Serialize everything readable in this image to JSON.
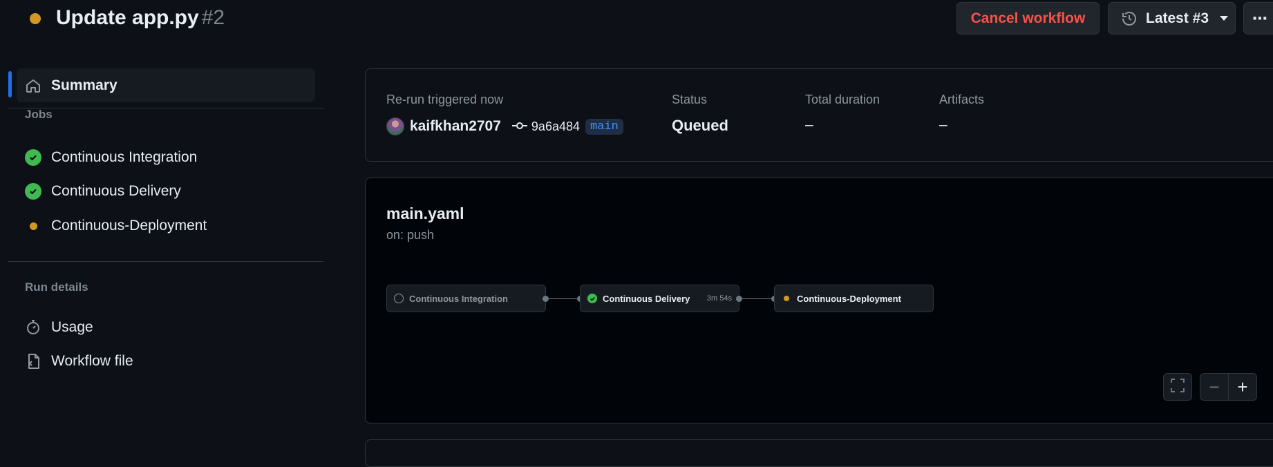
{
  "header": {
    "title": "Update app.py",
    "run_number": "#2",
    "cancel_label": "Cancel workflow",
    "latest_label": "Latest #3",
    "more_label": "⋯"
  },
  "sidebar": {
    "summary_label": "Summary",
    "jobs_heading": "Jobs",
    "jobs": [
      {
        "label": "Continuous Integration",
        "status": "success"
      },
      {
        "label": "Continuous Delivery",
        "status": "success"
      },
      {
        "label": "Continuous-Deployment",
        "status": "queued"
      }
    ],
    "run_details_heading": "Run details",
    "details": [
      {
        "label": "Usage",
        "icon": "stopwatch-icon"
      },
      {
        "label": "Workflow file",
        "icon": "file-code-icon"
      }
    ]
  },
  "summary": {
    "trigger_label": "Re-run triggered now",
    "actor": "kaifkhan2707",
    "commit": "9a6a484",
    "branch": "main",
    "status_label": "Status",
    "status_value": "Queued",
    "duration_label": "Total duration",
    "duration_value": "–",
    "artifacts_label": "Artifacts",
    "artifacts_value": "–"
  },
  "graph": {
    "workflow_name": "main.yaml",
    "trigger": "on: push",
    "jobs": [
      {
        "label": "Continuous Integration",
        "status": "pending",
        "duration": ""
      },
      {
        "label": "Continuous Delivery",
        "status": "success",
        "duration": "3m 54s"
      },
      {
        "label": "Continuous-Deployment",
        "status": "queued",
        "duration": ""
      }
    ],
    "zoom_out": "−",
    "zoom_in": "+"
  },
  "colors": {
    "background": "#0d1117",
    "queued": "#d29922",
    "success": "#3fb950",
    "danger": "#f85149",
    "accent": "#1f6feb"
  }
}
